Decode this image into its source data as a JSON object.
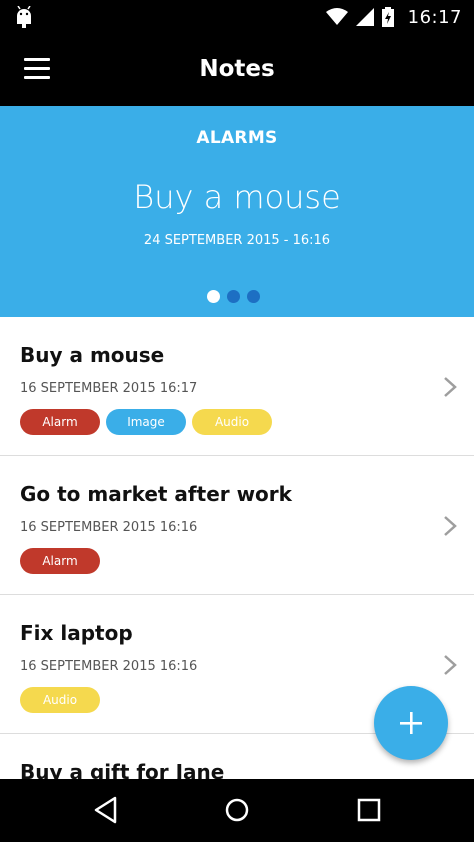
{
  "status_bar": {
    "time": "16:17",
    "icons": [
      "android-icon",
      "wifi-icon",
      "signal-icon",
      "battery-icon"
    ]
  },
  "app_bar": {
    "title": "Notes",
    "menu_icon": "hamburger-menu-icon"
  },
  "banner": {
    "category": "ALARMS",
    "title": "Buy a mouse",
    "date": "24  SEPTEMBER  2015 - 16:16",
    "page_count": 3,
    "active_page": 1,
    "colors": {
      "background": "#3aaee8",
      "dot": "#1d6fc3",
      "dot_active": "#ffffff"
    }
  },
  "notes": [
    {
      "title": "Buy a mouse",
      "date": "16 SEPTEMBER 2015  16:17",
      "tags": [
        "Alarm",
        "Image",
        "Audio"
      ]
    },
    {
      "title": "Go to market after work",
      "date": "16 SEPTEMBER 2015  16:16",
      "tags": [
        "Alarm"
      ]
    },
    {
      "title": "Fix laptop",
      "date": "16 SEPTEMBER 2015  16:16",
      "tags": [
        "Audio"
      ]
    },
    {
      "title": "Buy a gift for Jane",
      "date": "",
      "tags": []
    }
  ],
  "tag_colors": {
    "Alarm": "#c0392b",
    "Image": "#3aaee8",
    "Audio": "#f5d94e"
  },
  "fab": {
    "icon": "plus-icon",
    "color": "#3aaee8"
  },
  "nav_bar": {
    "icons": [
      "back-icon",
      "home-icon",
      "recents-icon"
    ]
  }
}
